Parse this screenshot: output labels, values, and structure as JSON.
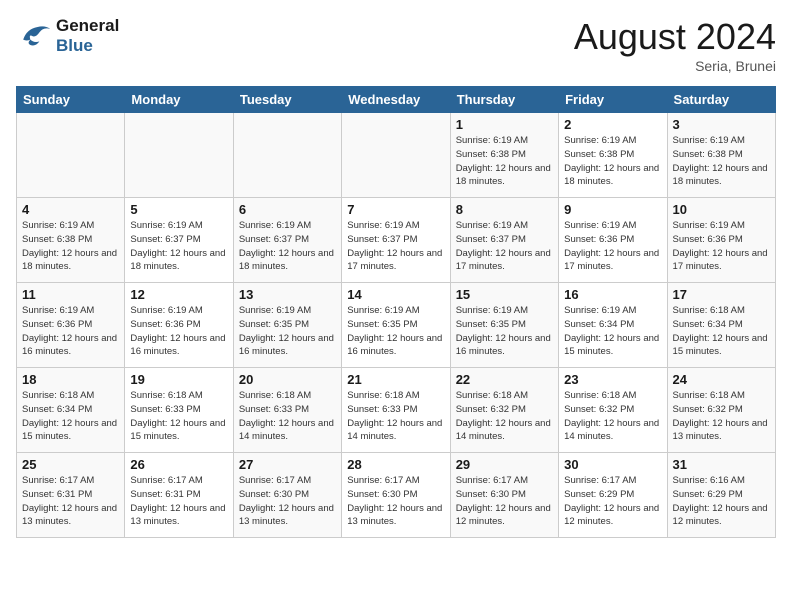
{
  "header": {
    "logo_line1": "General",
    "logo_line2": "Blue",
    "month_title": "August 2024",
    "location": "Seria, Brunei"
  },
  "weekdays": [
    "Sunday",
    "Monday",
    "Tuesday",
    "Wednesday",
    "Thursday",
    "Friday",
    "Saturday"
  ],
  "weeks": [
    [
      {
        "day": "",
        "info": ""
      },
      {
        "day": "",
        "info": ""
      },
      {
        "day": "",
        "info": ""
      },
      {
        "day": "",
        "info": ""
      },
      {
        "day": "1",
        "info": "Sunrise: 6:19 AM\nSunset: 6:38 PM\nDaylight: 12 hours\nand 18 minutes."
      },
      {
        "day": "2",
        "info": "Sunrise: 6:19 AM\nSunset: 6:38 PM\nDaylight: 12 hours\nand 18 minutes."
      },
      {
        "day": "3",
        "info": "Sunrise: 6:19 AM\nSunset: 6:38 PM\nDaylight: 12 hours\nand 18 minutes."
      }
    ],
    [
      {
        "day": "4",
        "info": "Sunrise: 6:19 AM\nSunset: 6:38 PM\nDaylight: 12 hours\nand 18 minutes."
      },
      {
        "day": "5",
        "info": "Sunrise: 6:19 AM\nSunset: 6:37 PM\nDaylight: 12 hours\nand 18 minutes."
      },
      {
        "day": "6",
        "info": "Sunrise: 6:19 AM\nSunset: 6:37 PM\nDaylight: 12 hours\nand 18 minutes."
      },
      {
        "day": "7",
        "info": "Sunrise: 6:19 AM\nSunset: 6:37 PM\nDaylight: 12 hours\nand 17 minutes."
      },
      {
        "day": "8",
        "info": "Sunrise: 6:19 AM\nSunset: 6:37 PM\nDaylight: 12 hours\nand 17 minutes."
      },
      {
        "day": "9",
        "info": "Sunrise: 6:19 AM\nSunset: 6:36 PM\nDaylight: 12 hours\nand 17 minutes."
      },
      {
        "day": "10",
        "info": "Sunrise: 6:19 AM\nSunset: 6:36 PM\nDaylight: 12 hours\nand 17 minutes."
      }
    ],
    [
      {
        "day": "11",
        "info": "Sunrise: 6:19 AM\nSunset: 6:36 PM\nDaylight: 12 hours\nand 16 minutes."
      },
      {
        "day": "12",
        "info": "Sunrise: 6:19 AM\nSunset: 6:36 PM\nDaylight: 12 hours\nand 16 minutes."
      },
      {
        "day": "13",
        "info": "Sunrise: 6:19 AM\nSunset: 6:35 PM\nDaylight: 12 hours\nand 16 minutes."
      },
      {
        "day": "14",
        "info": "Sunrise: 6:19 AM\nSunset: 6:35 PM\nDaylight: 12 hours\nand 16 minutes."
      },
      {
        "day": "15",
        "info": "Sunrise: 6:19 AM\nSunset: 6:35 PM\nDaylight: 12 hours\nand 16 minutes."
      },
      {
        "day": "16",
        "info": "Sunrise: 6:19 AM\nSunset: 6:34 PM\nDaylight: 12 hours\nand 15 minutes."
      },
      {
        "day": "17",
        "info": "Sunrise: 6:18 AM\nSunset: 6:34 PM\nDaylight: 12 hours\nand 15 minutes."
      }
    ],
    [
      {
        "day": "18",
        "info": "Sunrise: 6:18 AM\nSunset: 6:34 PM\nDaylight: 12 hours\nand 15 minutes."
      },
      {
        "day": "19",
        "info": "Sunrise: 6:18 AM\nSunset: 6:33 PM\nDaylight: 12 hours\nand 15 minutes."
      },
      {
        "day": "20",
        "info": "Sunrise: 6:18 AM\nSunset: 6:33 PM\nDaylight: 12 hours\nand 14 minutes."
      },
      {
        "day": "21",
        "info": "Sunrise: 6:18 AM\nSunset: 6:33 PM\nDaylight: 12 hours\nand 14 minutes."
      },
      {
        "day": "22",
        "info": "Sunrise: 6:18 AM\nSunset: 6:32 PM\nDaylight: 12 hours\nand 14 minutes."
      },
      {
        "day": "23",
        "info": "Sunrise: 6:18 AM\nSunset: 6:32 PM\nDaylight: 12 hours\nand 14 minutes."
      },
      {
        "day": "24",
        "info": "Sunrise: 6:18 AM\nSunset: 6:32 PM\nDaylight: 12 hours\nand 13 minutes."
      }
    ],
    [
      {
        "day": "25",
        "info": "Sunrise: 6:17 AM\nSunset: 6:31 PM\nDaylight: 12 hours\nand 13 minutes."
      },
      {
        "day": "26",
        "info": "Sunrise: 6:17 AM\nSunset: 6:31 PM\nDaylight: 12 hours\nand 13 minutes."
      },
      {
        "day": "27",
        "info": "Sunrise: 6:17 AM\nSunset: 6:30 PM\nDaylight: 12 hours\nand 13 minutes."
      },
      {
        "day": "28",
        "info": "Sunrise: 6:17 AM\nSunset: 6:30 PM\nDaylight: 12 hours\nand 13 minutes."
      },
      {
        "day": "29",
        "info": "Sunrise: 6:17 AM\nSunset: 6:30 PM\nDaylight: 12 hours\nand 12 minutes."
      },
      {
        "day": "30",
        "info": "Sunrise: 6:17 AM\nSunset: 6:29 PM\nDaylight: 12 hours\nand 12 minutes."
      },
      {
        "day": "31",
        "info": "Sunrise: 6:16 AM\nSunset: 6:29 PM\nDaylight: 12 hours\nand 12 minutes."
      }
    ]
  ]
}
